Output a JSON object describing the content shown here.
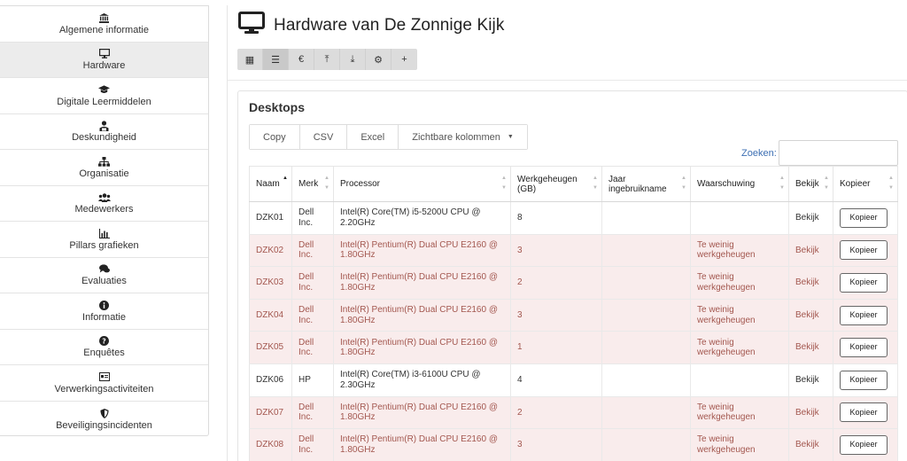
{
  "sidebar": {
    "items": [
      {
        "label": "Algemene informatie",
        "icon": "bank-icon",
        "active": false
      },
      {
        "label": "Hardware",
        "icon": "monitor-icon",
        "active": true
      },
      {
        "label": "Digitale Leermiddelen",
        "icon": "graduation-cap-icon",
        "active": false
      },
      {
        "label": "Deskundigheid",
        "icon": "person-icon",
        "active": false
      },
      {
        "label": "Organisatie",
        "icon": "org-chart-icon",
        "active": false
      },
      {
        "label": "Medewerkers",
        "icon": "users-icon",
        "active": false
      },
      {
        "label": "Pillars grafieken",
        "icon": "bar-chart-icon",
        "active": false
      },
      {
        "label": "Evaluaties",
        "icon": "comments-icon",
        "active": false
      },
      {
        "label": "Informatie",
        "icon": "info-icon",
        "active": false
      },
      {
        "label": "Enquêtes",
        "icon": "question-icon",
        "active": false
      },
      {
        "label": "Verwerkingsactiviteiten",
        "icon": "id-card-icon",
        "active": false
      },
      {
        "label": "Beveiligingsincidenten",
        "icon": "shield-icon",
        "active": false
      }
    ]
  },
  "header": {
    "title": "Hardware van De Zonnige Kijk",
    "icon": "monitor-icon"
  },
  "toolbar": {
    "buttons": [
      {
        "icon": "grid-icon",
        "glyph": "▦",
        "active": false
      },
      {
        "icon": "list-icon",
        "glyph": "☰",
        "active": true
      },
      {
        "icon": "euro-icon",
        "glyph": "€",
        "active": false
      },
      {
        "icon": "upload-icon",
        "glyph": "⤒",
        "active": false
      },
      {
        "icon": "download-icon",
        "glyph": "⤓",
        "active": false
      },
      {
        "icon": "cogs-icon",
        "glyph": "⚙",
        "active": false
      },
      {
        "icon": "plus-icon",
        "glyph": "+",
        "active": false
      }
    ]
  },
  "panel": {
    "title": "Desktops",
    "export_buttons": {
      "copy": "Copy",
      "csv": "CSV",
      "excel": "Excel",
      "columns": "Zichtbare kolommen"
    },
    "search_label": "Zoeken:",
    "search_value": ""
  },
  "table": {
    "headers": {
      "naam": "Naam",
      "merk": "Merk",
      "processor": "Processor",
      "werkgeheugen": "Werkgeheugen (GB)",
      "jaar": "Jaar ingebruikname",
      "waarschuwing": "Waarschuwing",
      "bekijk": "Bekijk",
      "kopieer": "Kopieer"
    },
    "rows": [
      {
        "naam": "DZK01",
        "merk": "Dell Inc.",
        "processor": "Intel(R) Core(TM) i5-5200U CPU @ 2.20GHz",
        "werkgeheugen": "8",
        "jaar": "",
        "waarschuwing": "",
        "bekijk": "Bekijk",
        "kopieer": "Kopieer",
        "warn": false
      },
      {
        "naam": "DZK02",
        "merk": "Dell Inc.",
        "processor": "Intel(R) Pentium(R) Dual CPU E2160 @ 1.80GHz",
        "werkgeheugen": "3",
        "jaar": "",
        "waarschuwing": "Te weinig werkgeheugen",
        "bekijk": "Bekijk",
        "kopieer": "Kopieer",
        "warn": true
      },
      {
        "naam": "DZK03",
        "merk": "Dell Inc.",
        "processor": "Intel(R) Pentium(R) Dual CPU E2160 @ 1.80GHz",
        "werkgeheugen": "2",
        "jaar": "",
        "waarschuwing": "Te weinig werkgeheugen",
        "bekijk": "Bekijk",
        "kopieer": "Kopieer",
        "warn": true
      },
      {
        "naam": "DZK04",
        "merk": "Dell Inc.",
        "processor": "Intel(R) Pentium(R) Dual CPU E2160 @ 1.80GHz",
        "werkgeheugen": "3",
        "jaar": "",
        "waarschuwing": "Te weinig werkgeheugen",
        "bekijk": "Bekijk",
        "kopieer": "Kopieer",
        "warn": true
      },
      {
        "naam": "DZK05",
        "merk": "Dell Inc.",
        "processor": "Intel(R) Pentium(R) Dual CPU E2160 @ 1.80GHz",
        "werkgeheugen": "1",
        "jaar": "",
        "waarschuwing": "Te weinig werkgeheugen",
        "bekijk": "Bekijk",
        "kopieer": "Kopieer",
        "warn": true
      },
      {
        "naam": "DZK06",
        "merk": "HP",
        "processor": "Intel(R) Core(TM) i3-6100U CPU @ 2.30GHz",
        "werkgeheugen": "4",
        "jaar": "",
        "waarschuwing": "",
        "bekijk": "Bekijk",
        "kopieer": "Kopieer",
        "warn": false
      },
      {
        "naam": "DZK07",
        "merk": "Dell Inc.",
        "processor": "Intel(R) Pentium(R) Dual CPU E2160 @ 1.80GHz",
        "werkgeheugen": "2",
        "jaar": "",
        "waarschuwing": "Te weinig werkgeheugen",
        "bekijk": "Bekijk",
        "kopieer": "Kopieer",
        "warn": true
      },
      {
        "naam": "DZK08",
        "merk": "Dell Inc.",
        "processor": "Intel(R) Pentium(R) Dual CPU E2160 @ 1.80GHz",
        "werkgeheugen": "3",
        "jaar": "",
        "waarschuwing": "Te weinig werkgeheugen",
        "bekijk": "Bekijk",
        "kopieer": "Kopieer",
        "warn": true
      }
    ]
  },
  "colors": {
    "warning_row_bg": "#f9ecec",
    "warning_text": "#a3574f",
    "link": "#3d6fb3"
  }
}
